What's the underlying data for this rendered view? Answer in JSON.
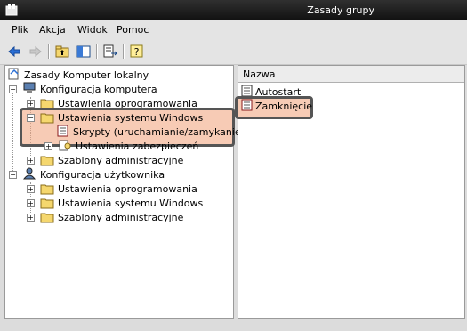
{
  "window": {
    "title": "Zasady grupy"
  },
  "menu": [
    "Plik",
    "Akcja",
    "Widok",
    "Pomoc"
  ],
  "tree": {
    "root": "Zasady Komputer lokalny",
    "computer_config": "Konfiguracja komputera",
    "computer_children": [
      "Ustawienia oprogramowania",
      "Ustawienia systemu Windows",
      "Skrypty (uruchamianie/zamykanie)",
      "Ustawienia zabezpieczeń",
      "Szablony administracyjne"
    ],
    "user_config": "Konfiguracja użytkownika",
    "user_children": [
      "Ustawienia oprogramowania",
      "Ustawienia systemu Windows",
      "Szablony administracyjne"
    ]
  },
  "list": {
    "column_name": "Nazwa",
    "items": [
      "Autostart",
      "Zamknięcie"
    ]
  },
  "colors": {
    "highlight": "#f0a078",
    "highlight_border": "#555555"
  }
}
